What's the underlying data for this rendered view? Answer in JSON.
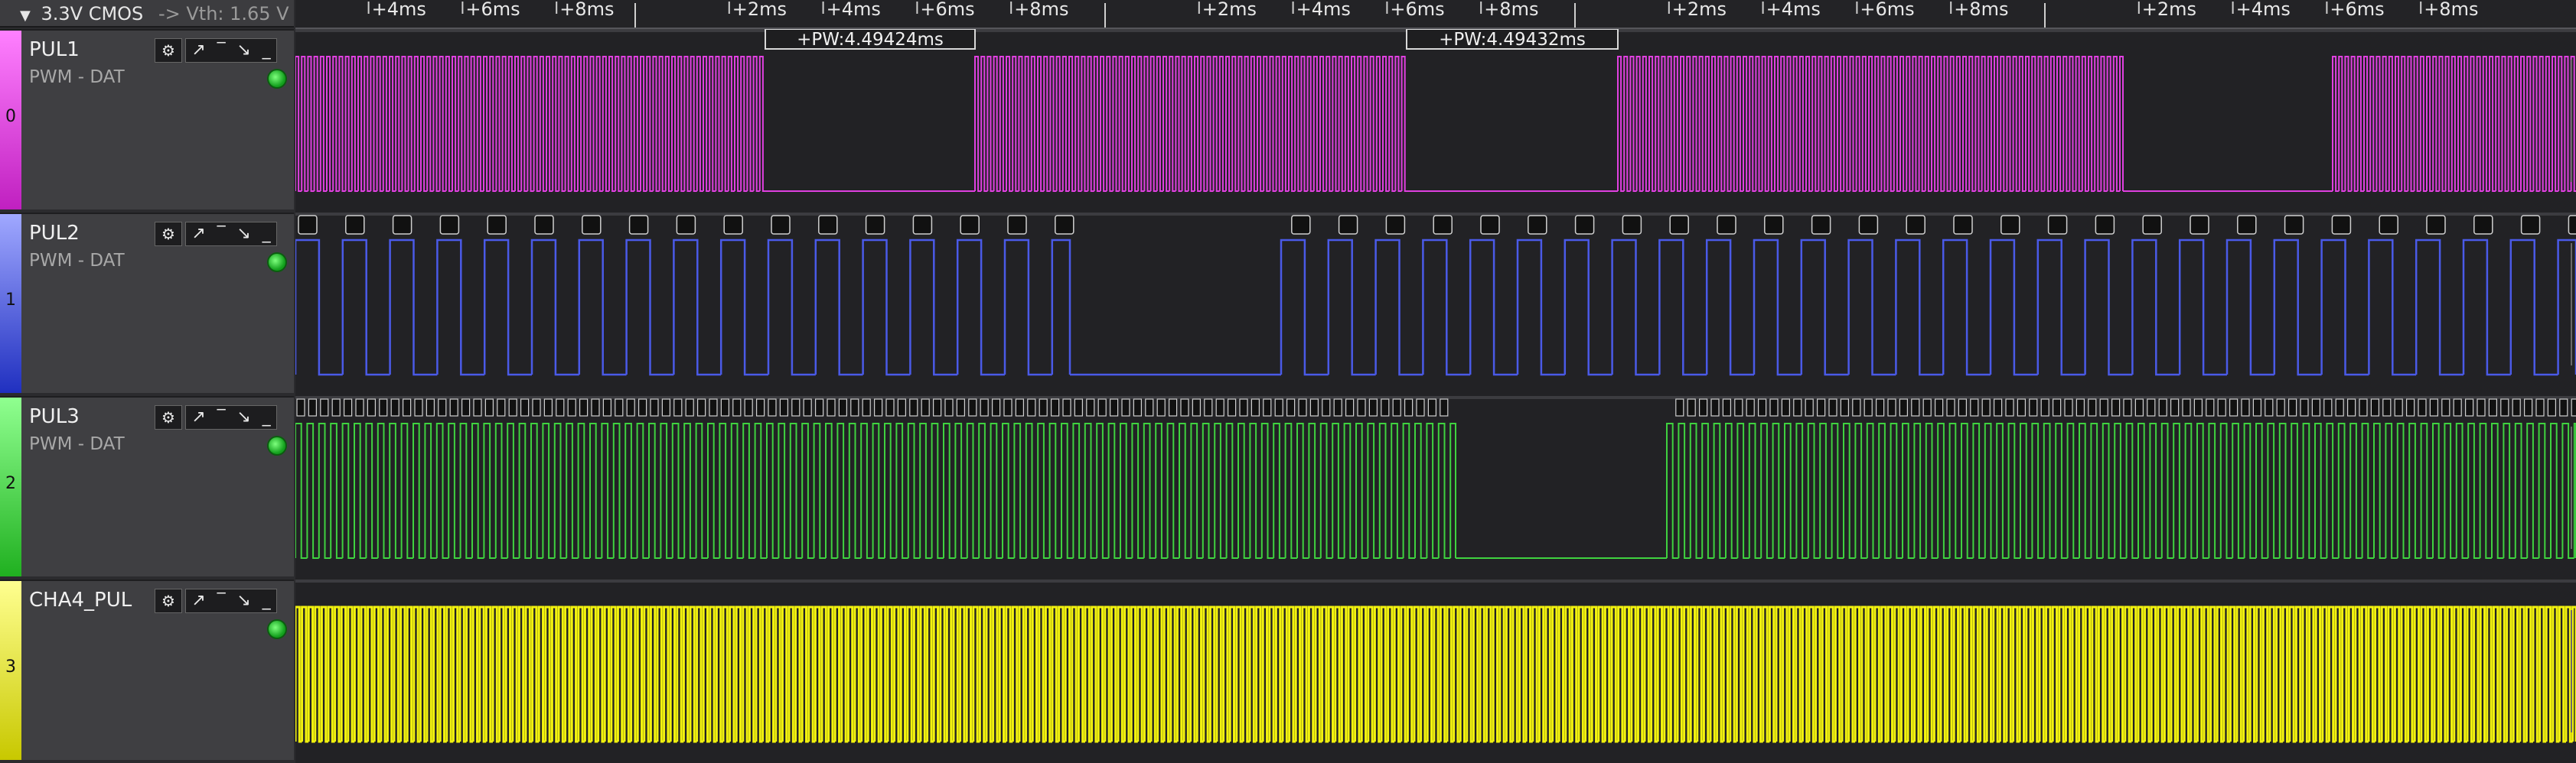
{
  "header": {
    "collapse_glyph": "▼",
    "voltage_label": "3.3V CMOS",
    "arrow_text": "->",
    "vth_label": "Vth: 1.65 V"
  },
  "ruler": {
    "groups": [
      [
        "+4ms",
        "+6ms",
        "+8ms"
      ],
      [
        "+2ms",
        "+4ms",
        "+6ms",
        "+8ms"
      ],
      [
        "+2ms",
        "+4ms",
        "+6ms",
        "+8ms"
      ],
      [
        "+2ms",
        "+4ms",
        "+6ms",
        "+8ms"
      ],
      [
        "+2ms",
        "+4ms",
        "+6ms",
        "+8ms"
      ]
    ]
  },
  "measurements": [
    {
      "label": "+PW:4.49424ms"
    },
    {
      "label": "+PW:4.49432ms"
    }
  ],
  "channels": [
    {
      "index": "0",
      "name": "PUL1",
      "subtitle": "PWM - DAT",
      "color": "#e040e0",
      "strip": [
        "#ff80ff",
        "#c020c0"
      ],
      "icon": "gear-icon"
    },
    {
      "index": "1",
      "name": "PUL2",
      "subtitle": "PWM - DAT",
      "color": "#4a5ae8",
      "strip": [
        "#a0a8ff",
        "#2030c0"
      ],
      "icon": "gear-icon"
    },
    {
      "index": "2",
      "name": "PUL3",
      "subtitle": "PWM - DAT",
      "color": "#3fd23f",
      "strip": [
        "#90ff90",
        "#20b020"
      ],
      "icon": "gear-icon"
    },
    {
      "index": "3",
      "name": "CHA4_PUL",
      "subtitle": "",
      "color": "#f2f20e",
      "strip": [
        "#ffff90",
        "#c8c800"
      ],
      "icon": "gear-icon"
    }
  ],
  "tool_glyphs": {
    "settings": "⚙",
    "rising": "↗",
    "high": "‾",
    "falling": "↘",
    "low": "_"
  }
}
